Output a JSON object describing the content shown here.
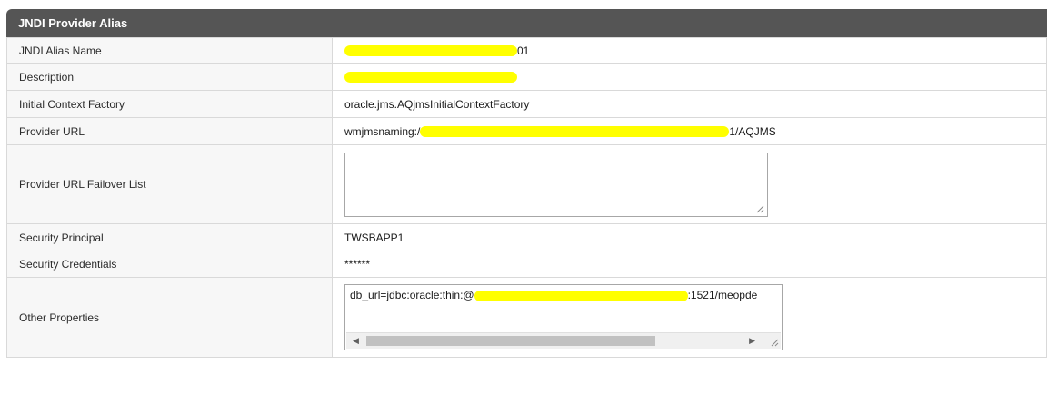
{
  "section": {
    "title": "JNDI Provider Alias"
  },
  "rows": {
    "alias_name": {
      "label": "JNDI Alias Name",
      "value_suffix": "01"
    },
    "description": {
      "label": "Description"
    },
    "initial_context_factory": {
      "label": "Initial Context Factory",
      "value": "oracle.jms.AQjmsInitialContextFactory"
    },
    "provider_url": {
      "label": "Provider URL",
      "prefix": "wmjmsnaming:/",
      "suffix": "1/AQJMS"
    },
    "failover_list": {
      "label": "Provider URL Failover List",
      "value": ""
    },
    "security_principal": {
      "label": "Security Principal",
      "value": "TWSBAPP1"
    },
    "security_credentials": {
      "label": "Security Credentials",
      "value": "******"
    },
    "other_properties": {
      "label": "Other Properties",
      "prefix": "db_url=jdbc:oracle:thin:@",
      "suffix": ":1521/meopde"
    }
  },
  "colors": {
    "header_bg": "#555555",
    "redaction": "#ffff00",
    "label_bg": "#f7f7f7",
    "border": "#d9d9d9"
  }
}
